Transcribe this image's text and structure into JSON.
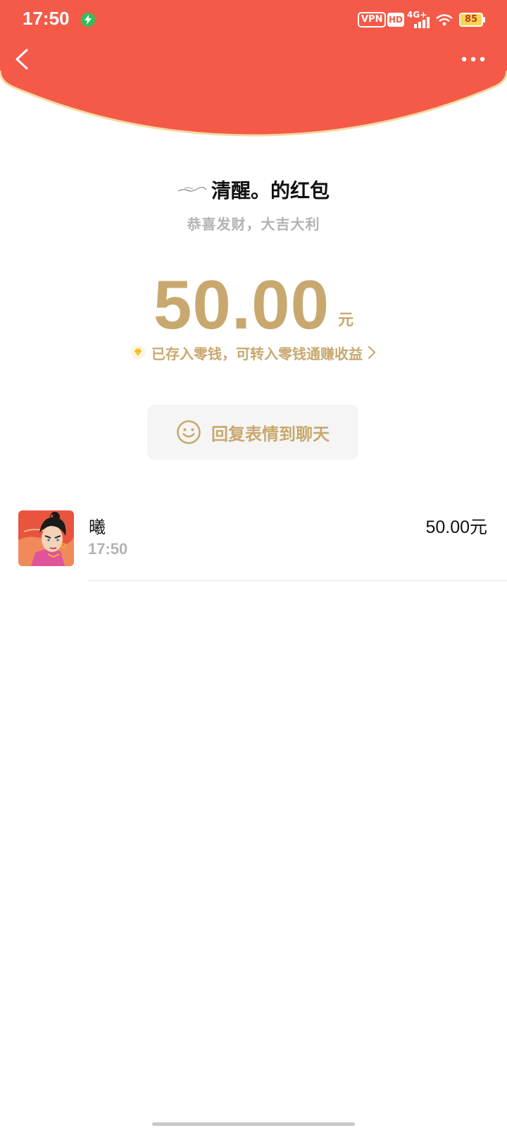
{
  "status_bar": {
    "time": "17:50",
    "vpn": "VPN",
    "hd": "HD",
    "network": "4G+",
    "battery": "85"
  },
  "envelope": {
    "title": "清醒。的红包",
    "greeting": "恭喜发财，大吉大利",
    "amount": "50.00",
    "unit": "元",
    "change_note": "已存入零钱，可转入零钱通赚收益",
    "reply_button": "回复表情到聊天"
  },
  "receipts": [
    {
      "name": "曦",
      "time": "17:50",
      "amount": "50.00元"
    }
  ],
  "colors": {
    "header_red": "#f55a48",
    "gold": "#c9a86f",
    "header_border": "#f5d9a0"
  }
}
